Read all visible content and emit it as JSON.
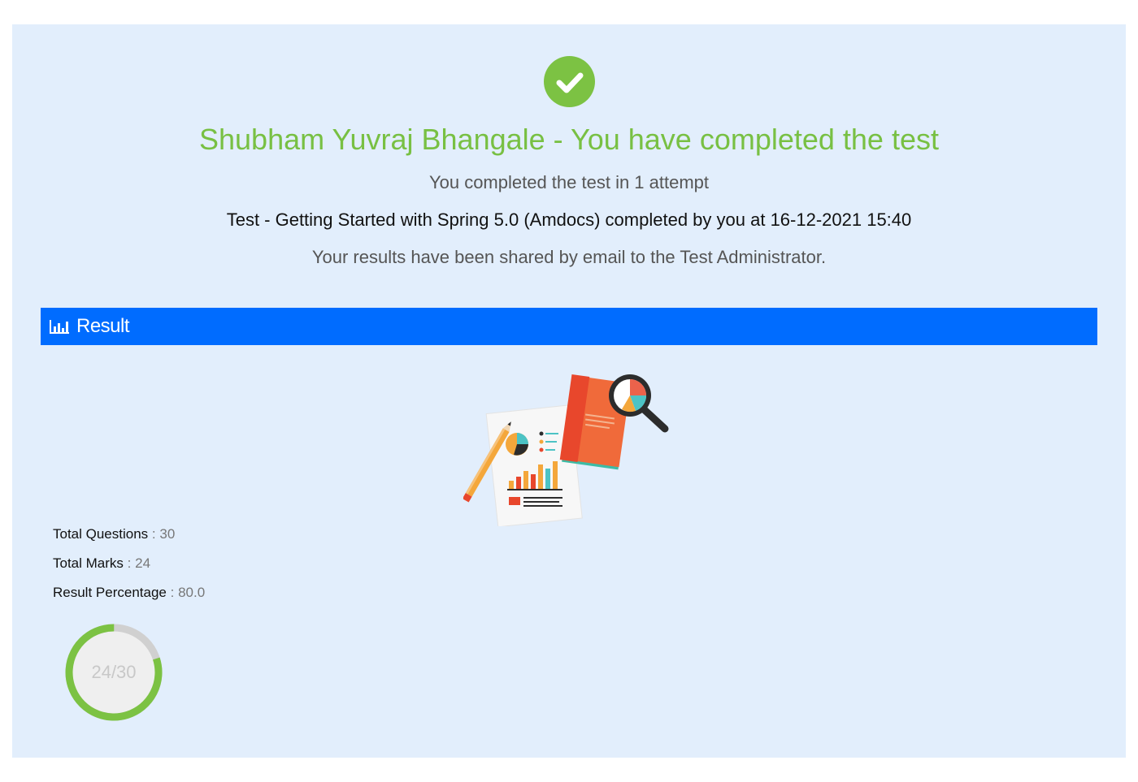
{
  "header": {
    "title": "Shubham Yuvraj Bhangale - You have completed the test",
    "attempt_text": "You completed the test in 1 attempt",
    "completed_text": "Test - Getting Started with Spring 5.0 (Amdocs) completed by you at 16-12-2021 15:40",
    "shared_text": "Your results have been shared by email to the Test Administrator.",
    "status_icon": "check-circle-icon",
    "accent_color": "#7cc243"
  },
  "result_section": {
    "label": "Result",
    "icon": "bar-chart-icon",
    "bar_color": "#006cff"
  },
  "stats": {
    "total_questions_label": "Total Questions",
    "total_questions_value": "30",
    "total_marks_label": "Total Marks",
    "total_marks_value": "24",
    "result_percentage_label": "Result Percentage",
    "result_percentage_value": "80.0",
    "separator": ":"
  },
  "score_donut": {
    "text": "24/30",
    "score": 24,
    "total": 30,
    "fill_color": "#7cc243",
    "track_color": "#d0d0d0"
  }
}
